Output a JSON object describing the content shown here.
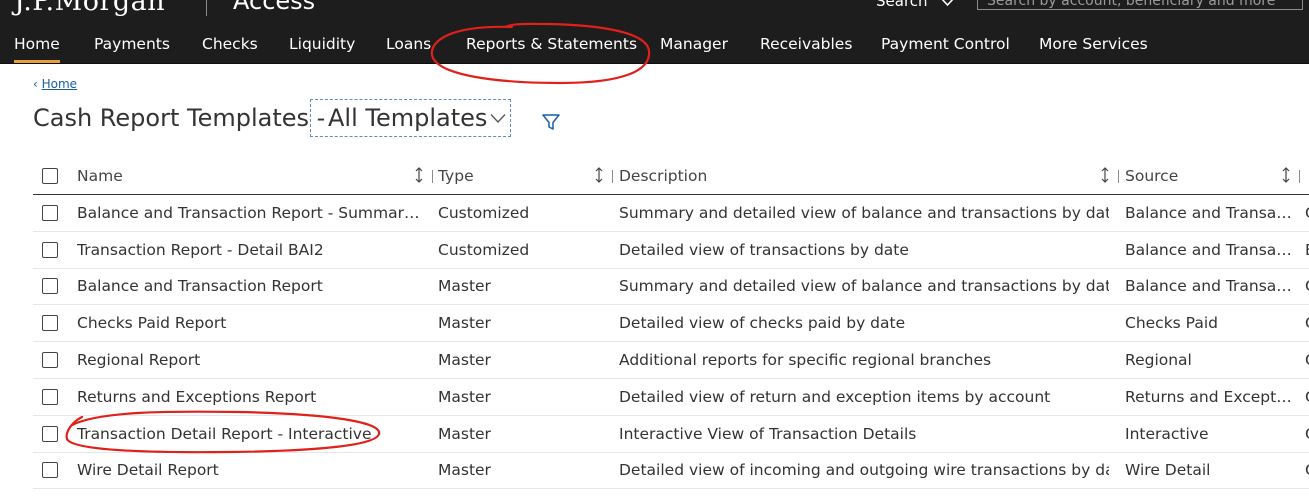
{
  "header": {
    "brand": "J.P.Morgan",
    "product": "Access",
    "search_scope": "Search",
    "search_placeholder": "Search by account, beneficiary and more"
  },
  "nav": {
    "items": [
      {
        "label": "Home",
        "active": true
      },
      {
        "label": "Payments"
      },
      {
        "label": "Checks"
      },
      {
        "label": "Liquidity"
      },
      {
        "label": "Loans"
      },
      {
        "label": "Reports & Statements"
      },
      {
        "label": "Manager"
      },
      {
        "label": "Receivables"
      },
      {
        "label": "Payment Control"
      },
      {
        "label": "More Services"
      }
    ]
  },
  "breadcrumb": {
    "home": "Home"
  },
  "page": {
    "title": "Cash Report Templates -",
    "template_filter": "All Templates"
  },
  "table": {
    "columns": {
      "name": "Name",
      "type": "Type",
      "description": "Description",
      "source": "Source"
    },
    "rows": [
      {
        "name": "Balance and Transaction Report - Summary and Detail",
        "type": "Customized",
        "description": "Summary and detailed view of balance and transactions by date",
        "source": "Balance and Transaction",
        "extra": "C"
      },
      {
        "name": "Transaction Report - Detail BAI2",
        "type": "Customized",
        "description": "Detailed view of transactions by date",
        "source": "Balance and Transaction",
        "extra": "E"
      },
      {
        "name": "Balance and Transaction Report",
        "type": "Master",
        "description": "Summary and detailed view of balance and transactions by date",
        "source": "Balance and Transaction",
        "extra": "C"
      },
      {
        "name": "Checks Paid Report",
        "type": "Master",
        "description": "Detailed view of checks paid by date",
        "source": "Checks Paid",
        "extra": "C"
      },
      {
        "name": "Regional Report",
        "type": "Master",
        "description": "Additional reports for specific regional branches",
        "source": "Regional",
        "extra": "C"
      },
      {
        "name": "Returns and Exceptions Report",
        "type": "Master",
        "description": "Detailed view of return and exception items by account",
        "source": "Returns and Exceptions",
        "extra": "C"
      },
      {
        "name": "Transaction Detail Report - Interactive",
        "type": "Master",
        "description": "Interactive View of Transaction Details",
        "source": "Interactive",
        "extra": "C"
      },
      {
        "name": "Wire Detail Report",
        "type": "Master",
        "description": "Detailed view of incoming and outgoing wire transactions by date",
        "source": "Wire Detail",
        "extra": "C"
      }
    ]
  },
  "colors": {
    "topbar": "#1d1d1d",
    "active_tab_underline": "#e5a03c",
    "link": "#1a5fa6",
    "annotation": "#e0201b"
  }
}
